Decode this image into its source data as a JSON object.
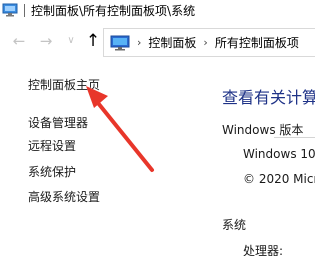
{
  "window": {
    "title": "控制面板\\所有控制面板项\\系统"
  },
  "address_bar": {
    "crumbs": [
      "控制面板",
      "所有控制面板项"
    ]
  },
  "left_nav": {
    "items": [
      "控制面板主页",
      "设备管理器",
      "远程设置",
      "系统保护",
      "高级系统设置"
    ]
  },
  "main": {
    "heading": "查看有关计算",
    "windows_edition": {
      "label": "Windows 版本",
      "name": "Windows 10",
      "copyright": "© 2020 Micr"
    },
    "system": {
      "label": "系统",
      "processor_label": "处理器:"
    }
  },
  "colors": {
    "heading": "#1e3287",
    "arrow": "#e8362a",
    "icon_blue": "#2a6ad0"
  }
}
